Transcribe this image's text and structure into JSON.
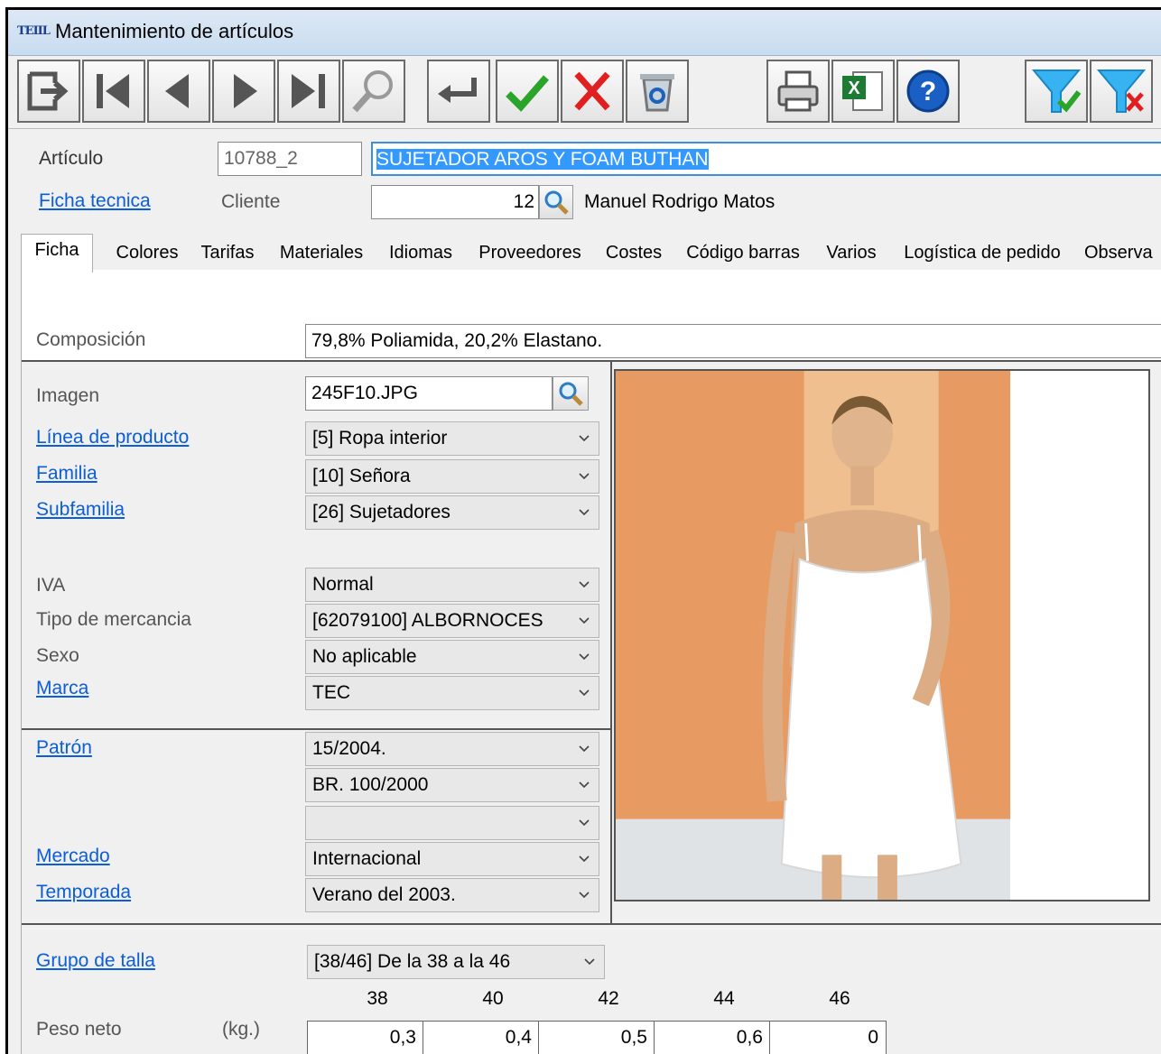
{
  "window": {
    "title": "Mantenimiento de artículos",
    "app_icon_text": "TEIIL"
  },
  "toolbar": {
    "buttons": [
      "exit-icon",
      "first-record-icon",
      "previous-record-icon",
      "next-record-icon",
      "last-record-icon",
      "search-icon",
      "enter-icon",
      "confirm-check-icon",
      "cancel-x-icon",
      "recycle-bin-icon",
      "printer-icon",
      "excel-export-icon",
      "help-icon",
      "filter-apply-icon",
      "filter-clear-icon"
    ]
  },
  "header": {
    "articulo_label": "Artículo",
    "articulo_code": "10788_2",
    "articulo_desc": "SUJETADOR AROS Y FOAM BUTHAN",
    "ficha_link": "Ficha tecnica",
    "cliente_label": "Cliente",
    "cliente_code": "12",
    "cliente_name": "Manuel Rodrigo Matos"
  },
  "tabs": [
    "Ficha",
    "Colores",
    "Tarifas",
    "Materiales",
    "Idiomas",
    "Proveedores",
    "Costes",
    "Código barras",
    "Varios",
    "Logística de pedido",
    "Observa"
  ],
  "ficha": {
    "composicion_label": "Composición",
    "composicion_value": "79,8% Poliamida, 20,2% Elastano.",
    "imagen_label": "Imagen",
    "imagen_value": "245F10.JPG",
    "linea_label": "Línea de producto",
    "linea_value": "[5] Ropa interior",
    "familia_label": "Familia",
    "familia_value": "[10] Señora",
    "subfamilia_label": "Subfamilia",
    "subfamilia_value": "[26] Sujetadores",
    "iva_label": "IVA",
    "iva_value": "Normal",
    "tipo_label": "Tipo de mercancia",
    "tipo_value": "[62079100] ALBORNOCES",
    "sexo_label": "Sexo",
    "sexo_value": "No aplicable",
    "marca_label": "Marca",
    "marca_value": "TEC",
    "patron_label": "Patrón",
    "patron_value1": "15/2004.",
    "patron_value2": "BR. 100/2000",
    "patron_value3": "",
    "mercado_label": "Mercado",
    "mercado_value": "Internacional",
    "temporada_label": "Temporada",
    "temporada_value": "Verano del 2003.",
    "grupo_label": "Grupo de talla",
    "grupo_value": "[38/46] De la 38 a la 46",
    "sizes": [
      "38",
      "40",
      "42",
      "44",
      "46"
    ],
    "peso_label": "Peso neto",
    "peso_unit": "(kg.)",
    "peso_values": [
      "0,3",
      "0,4",
      "0,5",
      "0,6",
      "0"
    ]
  }
}
